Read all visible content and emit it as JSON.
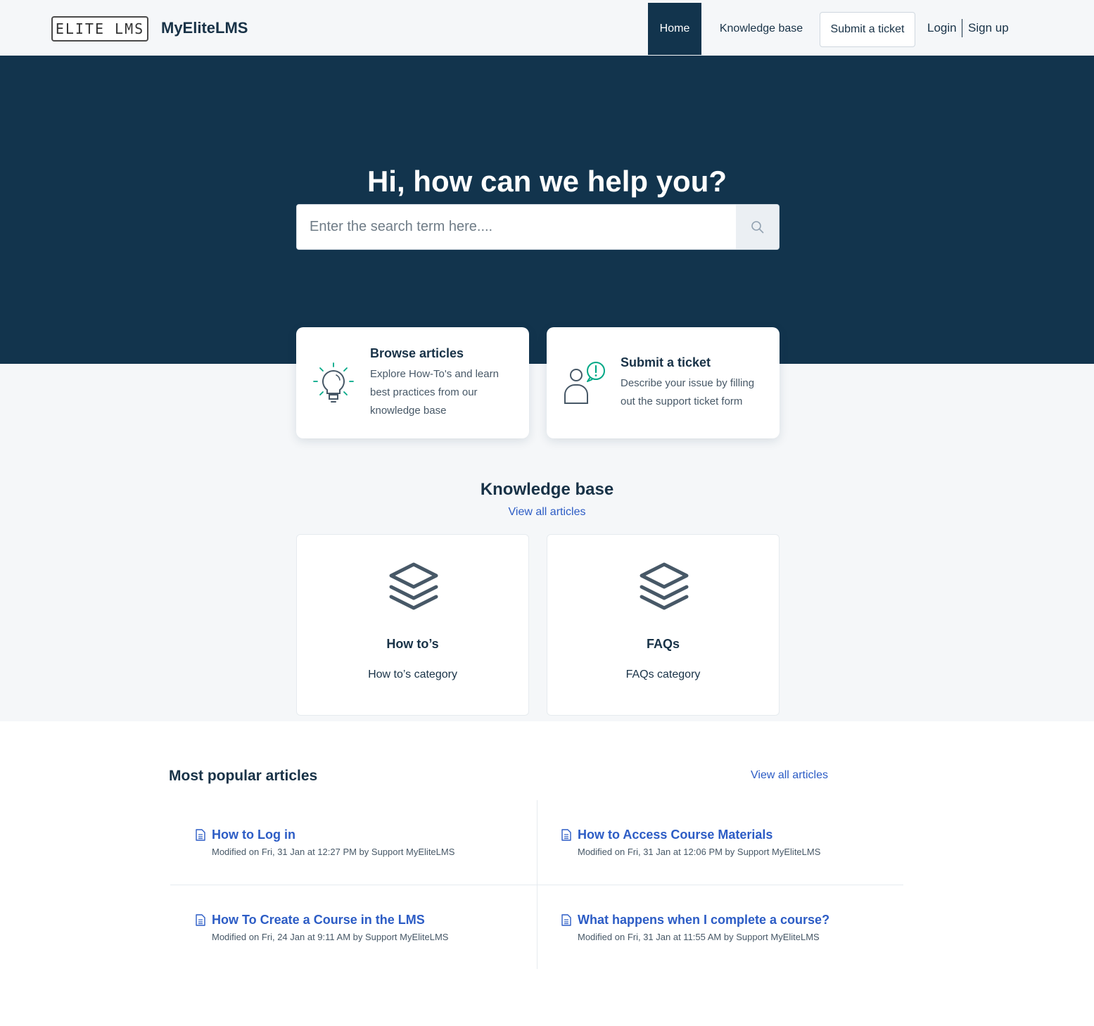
{
  "header": {
    "logo_text": "ELITE LMS",
    "brand_name": "MyEliteLMS",
    "nav": {
      "home": "Home",
      "knowledge_base": "Knowledge base",
      "submit_ticket": "Submit a ticket",
      "login": "Login",
      "signup": "Sign up"
    }
  },
  "hero": {
    "title": "Hi, how can we help you?",
    "search_placeholder": "Enter the search term here...."
  },
  "actions": [
    {
      "title": "Browse articles",
      "description": "Explore How-To's and learn best practices from our knowledge base",
      "icon": "lightbulb-icon"
    },
    {
      "title": "Submit a ticket",
      "description": "Describe your issue by filling out the support ticket form",
      "icon": "person-alert-icon"
    }
  ],
  "knowledge_base": {
    "title": "Knowledge base",
    "view_all": "View all articles",
    "categories": [
      {
        "name": "How to’s",
        "description": "How to’s category",
        "icon": "layers-icon"
      },
      {
        "name": "FAQs",
        "description": "FAQs category",
        "icon": "layers-icon"
      }
    ]
  },
  "popular": {
    "title": "Most popular articles",
    "view_all": "View all articles",
    "articles": [
      {
        "title": "How to Log in",
        "meta": "Modified on Fri, 31 Jan at 12:27 PM by Support MyEliteLMS"
      },
      {
        "title": "How to Access Course Materials",
        "meta": "Modified on Fri, 31 Jan at 12:06 PM by Support MyEliteLMS"
      },
      {
        "title": "How To Create a Course in the LMS",
        "meta": "Modified on Fri, 24 Jan at 9:11 AM by Support MyEliteLMS"
      },
      {
        "title": "What happens when I complete a course?",
        "meta": "Modified on Fri, 31 Jan at 11:55 AM by Support MyEliteLMS"
      }
    ]
  },
  "colors": {
    "navy": "#12344d",
    "accent_green": "#00a886",
    "link_blue": "#2c5cc5",
    "background_gray": "#f5f7f9"
  }
}
